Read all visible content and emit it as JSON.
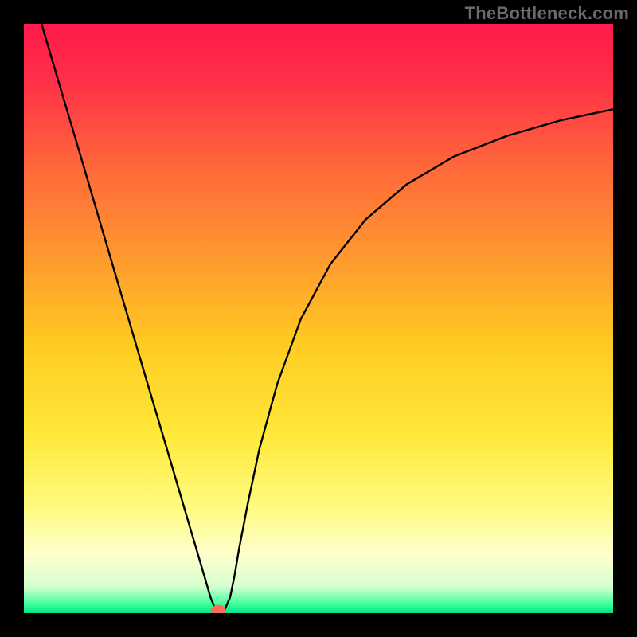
{
  "watermark": "TheBottleneck.com",
  "chart_data": {
    "type": "line",
    "title": "",
    "xlabel": "",
    "ylabel": "",
    "xlim": [
      0,
      1
    ],
    "ylim": [
      0,
      1
    ],
    "grid": false,
    "legend": false,
    "background_gradient": {
      "stops": [
        {
          "offset": 0.0,
          "color": "#ff1a4b"
        },
        {
          "offset": 0.1,
          "color": "#ff3147"
        },
        {
          "offset": 0.25,
          "color": "#ff6a3a"
        },
        {
          "offset": 0.4,
          "color": "#ff9a2e"
        },
        {
          "offset": 0.55,
          "color": "#ffcc22"
        },
        {
          "offset": 0.7,
          "color": "#ffe93a"
        },
        {
          "offset": 0.82,
          "color": "#fffb80"
        },
        {
          "offset": 0.9,
          "color": "#ffffcc"
        },
        {
          "offset": 0.955,
          "color": "#d6ffcf"
        },
        {
          "offset": 0.985,
          "color": "#3dff9a"
        },
        {
          "offset": 1.0,
          "color": "#00e38a"
        }
      ]
    },
    "series": [
      {
        "name": "curve",
        "color": "#000000",
        "x": [
          0.03,
          0.06,
          0.09,
          0.12,
          0.15,
          0.18,
          0.21,
          0.24,
          0.27,
          0.29,
          0.305,
          0.317,
          0.326,
          0.333,
          0.34,
          0.35,
          0.357,
          0.365,
          0.38,
          0.4,
          0.43,
          0.47,
          0.52,
          0.58,
          0.65,
          0.73,
          0.82,
          0.91,
          1.0
        ],
        "y": [
          1.0,
          0.898,
          0.797,
          0.695,
          0.593,
          0.491,
          0.389,
          0.288,
          0.186,
          0.118,
          0.067,
          0.026,
          0.004,
          0.004,
          0.004,
          0.027,
          0.061,
          0.108,
          0.186,
          0.28,
          0.389,
          0.499,
          0.592,
          0.668,
          0.728,
          0.775,
          0.81,
          0.836,
          0.855
        ]
      }
    ],
    "marker": {
      "name": "minimum-marker",
      "shape": "ellipse",
      "color": "#ff6c5a",
      "cx": 0.33,
      "cy": 0.004,
      "rx": 0.013,
      "ry": 0.01
    }
  }
}
